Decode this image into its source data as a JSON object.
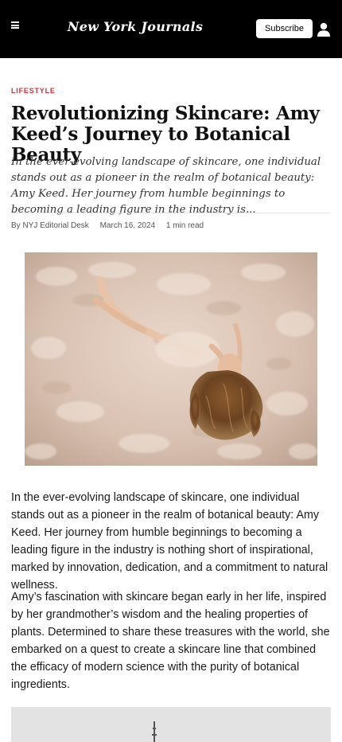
{
  "header": {
    "logo": "New York Journals",
    "subscribe_label": "Subscribe",
    "menu_icon": "hamburger-menu-icon",
    "user_icon": "user-account-icon",
    "background_color": "#000000"
  },
  "article": {
    "category": "LIFESTYLE",
    "category_color": "#d0303a",
    "title": "Revolutionizing Skincare: Amy Keed’s Journey to Botanical Beauty",
    "dek": "In the ever-evolving landscape of skincare, one individual stands out as a pioneer in the realm of botanical beauty: Amy Keed. Her journey from humble beginnings to becoming a leading figure in the industry is...",
    "byline": "By NYJ Editorial Desk",
    "date": "March 16, 2024",
    "read_time": "1 min read",
    "paragraphs": [
      "In the ever-evolving landscape of skincare, one individual stands out as a pioneer in the realm of botanical beauty: Amy Keed. Her journey from humble beginnings to becoming a leading figure in the industry is nothing short of inspirational, marked by innovation, dedication, and a commitment to natural wellness.",
      "Amy’s fascination with skincare began early in her life, inspired by her grandmother’s wisdom and the healing properties of plants. Determined to share these treasures with the world, she embarked on a quest to create a skincare line that combined the efficacy of modern science with the purity of botanical ingredients."
    ]
  }
}
